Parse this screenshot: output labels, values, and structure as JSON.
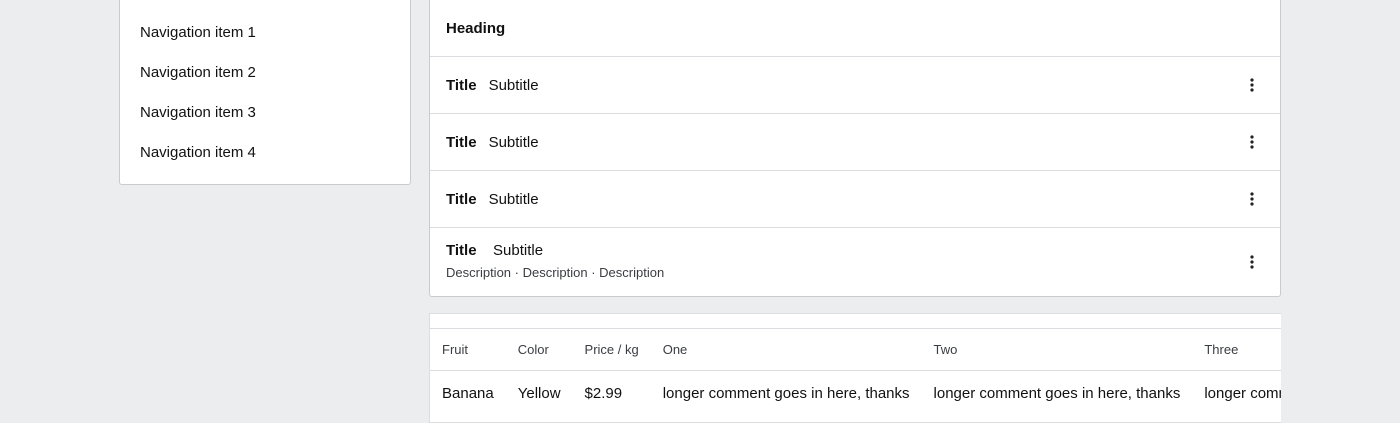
{
  "navigation": {
    "items": [
      {
        "label": "Navigation item 1"
      },
      {
        "label": "Navigation item 2"
      },
      {
        "label": "Navigation item 3"
      },
      {
        "label": "Navigation item 4"
      }
    ]
  },
  "list": {
    "heading": "Heading",
    "rows": [
      {
        "title": "Title",
        "subtitle": "Subtitle",
        "menu_icon": "more-vertical-icon"
      },
      {
        "title": "Title",
        "subtitle": "Subtitle",
        "menu_icon": "more-vertical-icon"
      },
      {
        "title": "Title",
        "subtitle": "Subtitle",
        "menu_icon": "more-vertical-icon"
      },
      {
        "title": "Title",
        "subtitle": "Subtitle",
        "description": "Description · Description · Description",
        "menu_icon": "more-vertical-icon"
      }
    ]
  },
  "table": {
    "columns": [
      "Fruit",
      "Color",
      "Price / kg",
      "One",
      "Two",
      "Three"
    ],
    "rows": [
      [
        "Banana",
        "Yellow",
        "$2.99",
        "longer comment goes in here, thanks",
        "longer comment goes in here, thanks",
        "longer comment goes in here, thanks"
      ]
    ]
  }
}
